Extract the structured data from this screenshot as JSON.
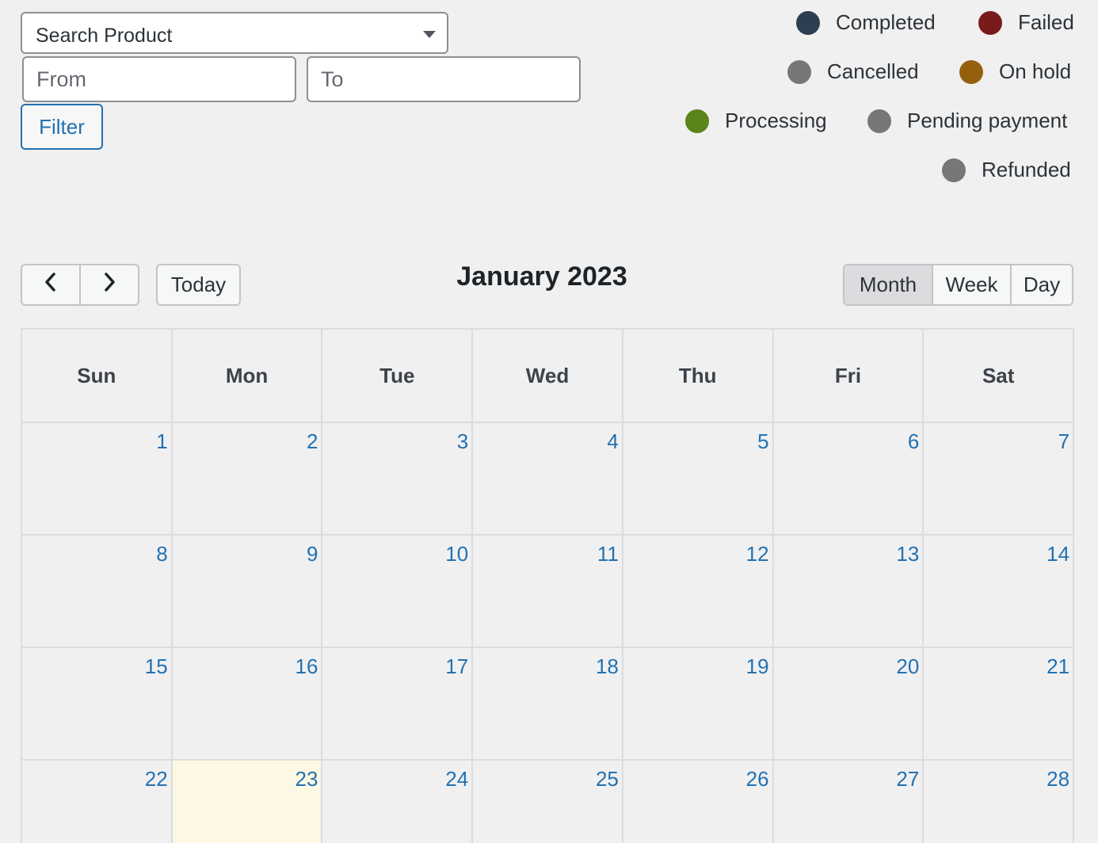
{
  "filters": {
    "product_select": "Search Product",
    "from_placeholder": "From",
    "to_placeholder": "To",
    "filter_label": "Filter"
  },
  "legend": [
    {
      "label": "Completed",
      "color": "#2c3e50"
    },
    {
      "label": "Failed",
      "color": "#7b1a1a"
    },
    {
      "label": "Cancelled",
      "color": "#777777"
    },
    {
      "label": "On hold",
      "color": "#93600b"
    },
    {
      "label": "Processing",
      "color": "#5b841b"
    },
    {
      "label": "Pending payment",
      "color": "#777777"
    },
    {
      "label": "Refunded",
      "color": "#777777"
    }
  ],
  "toolbar": {
    "prev_icon": "‹",
    "next_icon": "›",
    "today_label": "Today",
    "title": "January 2023",
    "views": [
      "Month",
      "Week",
      "Day"
    ],
    "active_view": "Month"
  },
  "calendar": {
    "weekdays": [
      "Sun",
      "Mon",
      "Tue",
      "Wed",
      "Thu",
      "Fri",
      "Sat"
    ],
    "weeks": [
      [
        "1",
        "2",
        "3",
        "4",
        "5",
        "6",
        "7"
      ],
      [
        "8",
        "9",
        "10",
        "11",
        "12",
        "13",
        "14"
      ],
      [
        "15",
        "16",
        "17",
        "18",
        "19",
        "20",
        "21"
      ],
      [
        "22",
        "23",
        "24",
        "25",
        "26",
        "27",
        "28"
      ]
    ],
    "today": "23"
  }
}
